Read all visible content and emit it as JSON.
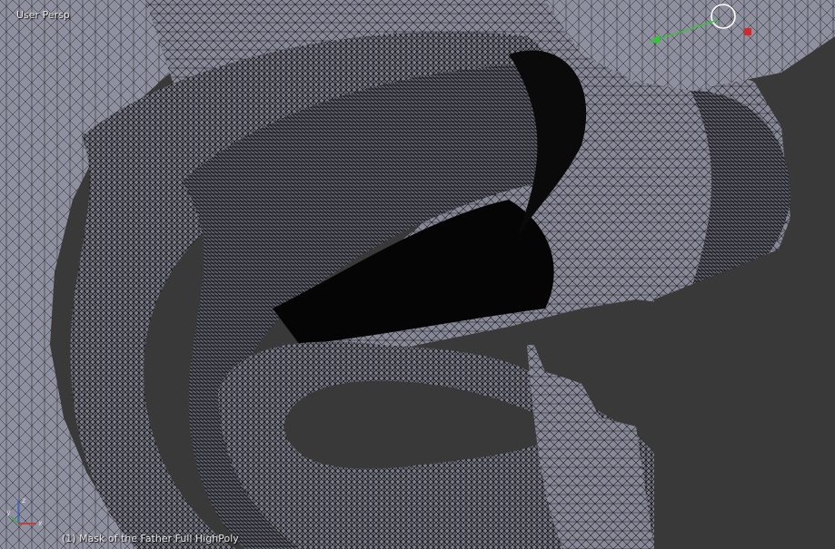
{
  "viewport": {
    "view_label": "User Persp",
    "object_label": "(1) Mask of the Father Full HighPoly",
    "colors": {
      "background": "#393939",
      "mesh_fill": "#8d8f9e",
      "mesh_wire": "#111111",
      "void": "#050505"
    }
  },
  "gizmos": {
    "transform_widget": {
      "icon": "rotate-widget-circle",
      "x_color": "#d62828",
      "y_color": "#3fbf3f"
    },
    "axes_indicator": {
      "icon": "xyz-axes",
      "x_label": "x",
      "y_label": "y",
      "z_label": "z",
      "x_color": "#d12a2a",
      "y_color": "#33b233",
      "z_color": "#3a6fd8"
    }
  }
}
